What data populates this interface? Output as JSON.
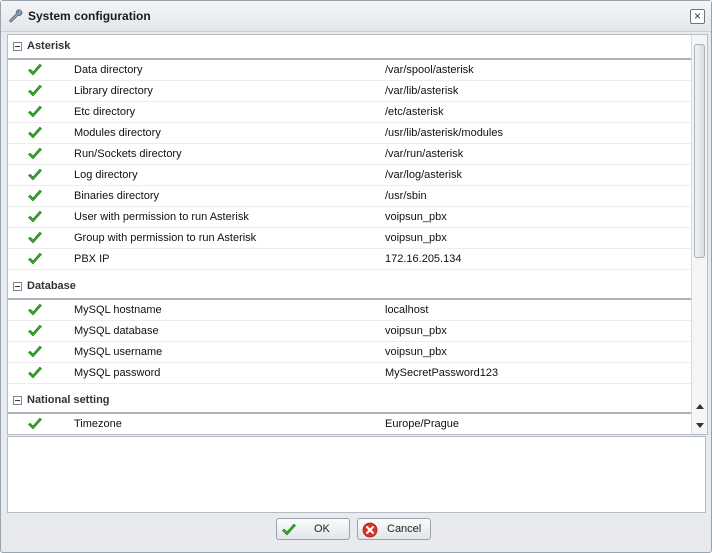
{
  "window": {
    "title": "System configuration",
    "title_icon": "wrench-icon",
    "close_icon": "close-icon"
  },
  "groups": [
    {
      "label": "Asterisk",
      "rows": [
        {
          "name": "Data directory",
          "value": "/var/spool/asterisk",
          "status": "ok"
        },
        {
          "name": "Library directory",
          "value": "/var/lib/asterisk",
          "status": "ok"
        },
        {
          "name": "Etc directory",
          "value": "/etc/asterisk",
          "status": "ok"
        },
        {
          "name": "Modules directory",
          "value": "/usr/lib/asterisk/modules",
          "status": "ok"
        },
        {
          "name": "Run/Sockets directory",
          "value": "/var/run/asterisk",
          "status": "ok"
        },
        {
          "name": "Log directory",
          "value": "/var/log/asterisk",
          "status": "ok"
        },
        {
          "name": "Binaries directory",
          "value": "/usr/sbin",
          "status": "ok"
        },
        {
          "name": "User with permission to run Asterisk",
          "value": "voipsun_pbx",
          "status": "ok"
        },
        {
          "name": "Group with permission to run Asterisk",
          "value": "voipsun_pbx",
          "status": "ok"
        },
        {
          "name": "PBX IP",
          "value": "172.16.205.134",
          "status": "ok"
        }
      ]
    },
    {
      "label": "Database",
      "rows": [
        {
          "name": "MySQL hostname",
          "value": "localhost",
          "status": "ok"
        },
        {
          "name": "MySQL database",
          "value": "voipsun_pbx",
          "status": "ok"
        },
        {
          "name": "MySQL username",
          "value": "voipsun_pbx",
          "status": "ok"
        },
        {
          "name": "MySQL password",
          "value": "MySecretPassword123",
          "status": "ok"
        }
      ]
    },
    {
      "label": "National setting",
      "rows": [
        {
          "name": "Timezone",
          "value": "Europe/Prague",
          "status": "ok"
        }
      ]
    }
  ],
  "notes": {
    "value": ""
  },
  "buttons": {
    "ok": {
      "label": "OK",
      "icon": "checkmark-icon"
    },
    "cancel": {
      "label": "Cancel",
      "icon": "cancel-icon"
    }
  },
  "colors": {
    "check_green": "#3aa62f",
    "cancel_red": "#d9342b"
  }
}
